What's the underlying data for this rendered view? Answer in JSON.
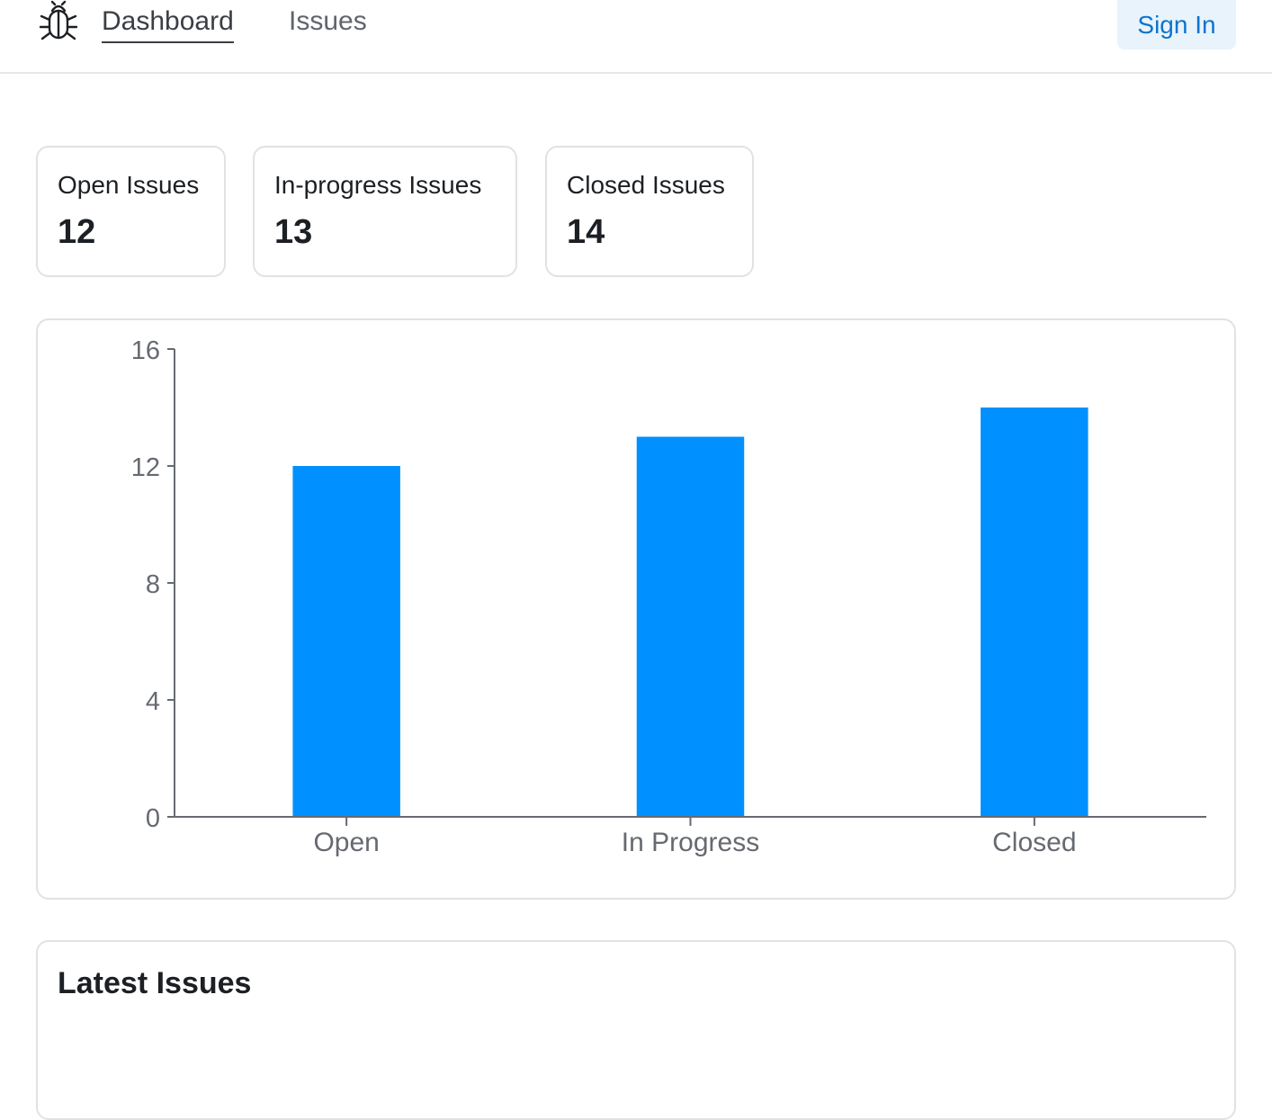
{
  "nav": {
    "logo_icon": "bug-icon",
    "links": [
      {
        "label": "Dashboard",
        "active": true
      },
      {
        "label": "Issues",
        "active": false
      }
    ],
    "signin_label": "Sign In"
  },
  "summary": [
    {
      "label": "Open Issues",
      "value": "12"
    },
    {
      "label": "In-progress Issues",
      "value": "13"
    },
    {
      "label": "Closed Issues",
      "value": "14"
    }
  ],
  "chart_data": {
    "type": "bar",
    "categories": [
      "Open",
      "In Progress",
      "Closed"
    ],
    "values": [
      12,
      13,
      14
    ],
    "yticks": [
      0,
      4,
      8,
      12,
      16
    ],
    "ylim": [
      0,
      16
    ],
    "grid": false,
    "bar_color": "#0090ff"
  },
  "latest": {
    "title": "Latest Issues"
  },
  "colors": {
    "accent": "#0090ff",
    "signin_bg": "#e8f3fc",
    "signin_text": "#0d74ce"
  }
}
